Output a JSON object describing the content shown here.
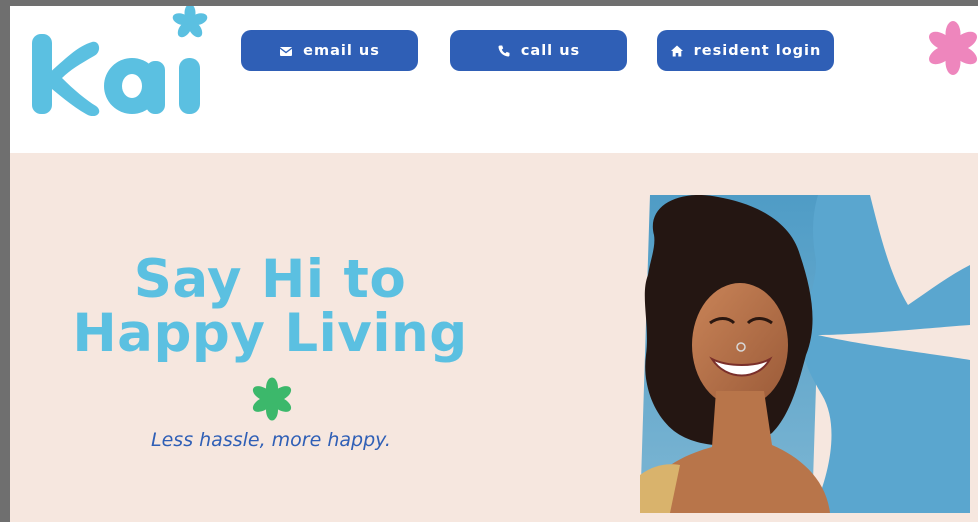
{
  "brand": {
    "logo_text": "kai"
  },
  "header": {
    "buttons": [
      {
        "label": "email us",
        "icon": "envelope-icon"
      },
      {
        "label": "call us",
        "icon": "phone-icon"
      },
      {
        "label": "resident login",
        "icon": "home-icon"
      }
    ]
  },
  "hero": {
    "headline_line1": "Say Hi to",
    "headline_line2": "Happy Living",
    "tagline": "Less hassle, more happy."
  },
  "colors": {
    "logo": "#5bc0e1",
    "button": "#2f5fb6",
    "hero_background": "#f6e7df",
    "headline": "#5bc0e1",
    "tagline": "#2f5fb6",
    "accent_pink": "#ee86bd",
    "accent_green": "#3cb86b"
  }
}
